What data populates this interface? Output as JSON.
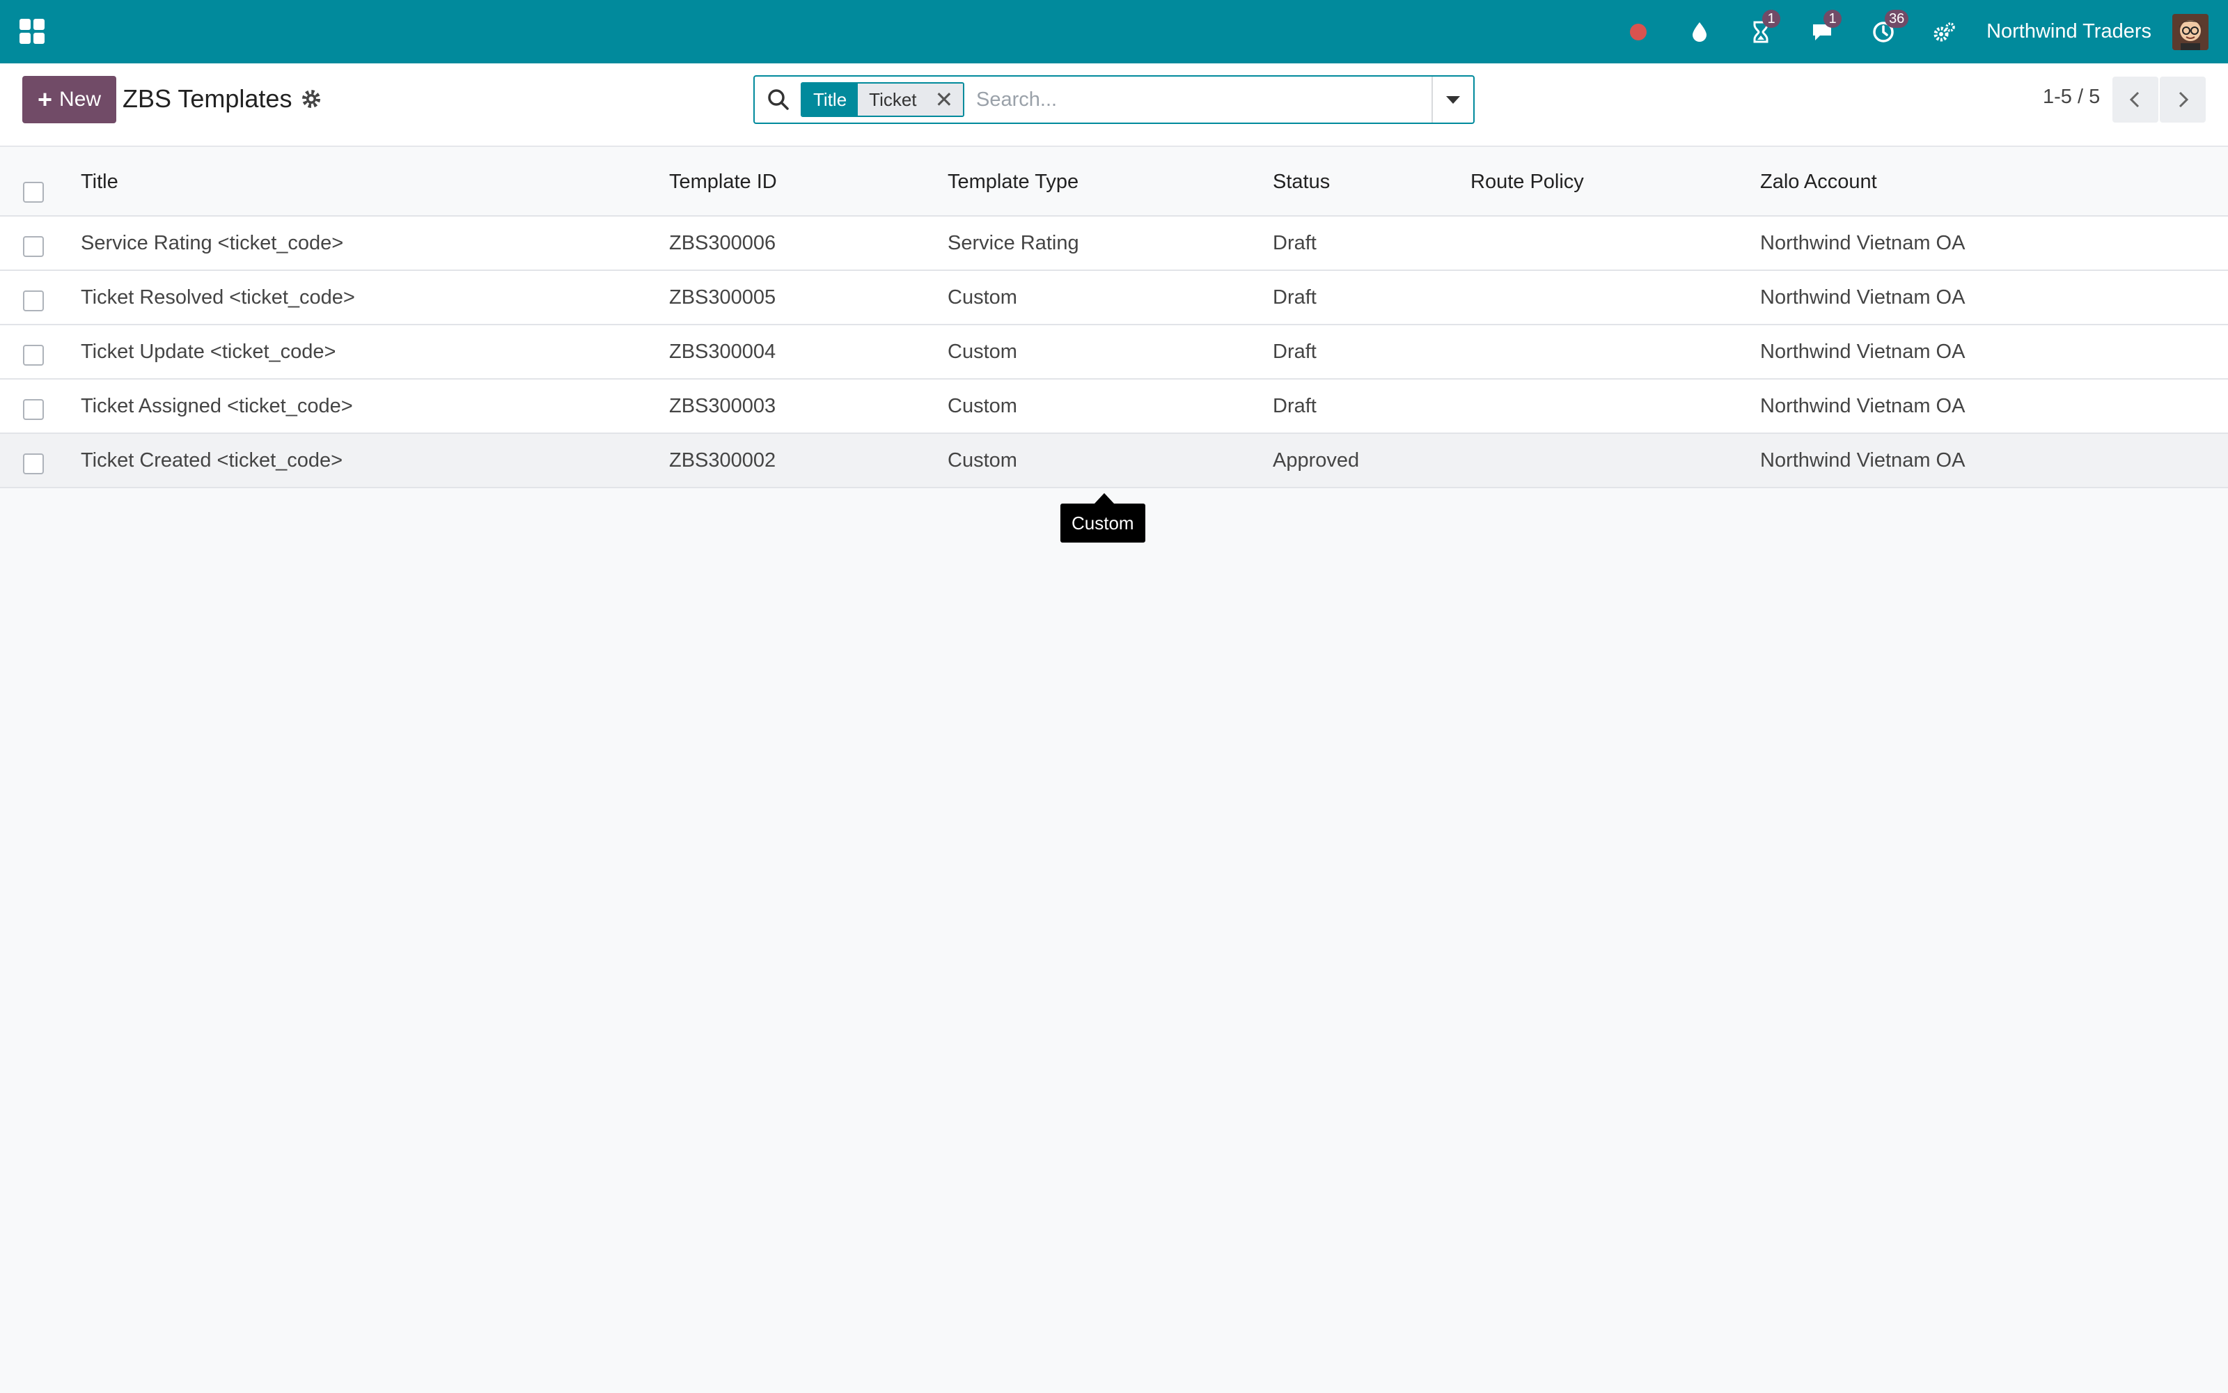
{
  "colors": {
    "navbar": "#018a9c",
    "primary_button": "#714b67",
    "badge": "#714b67",
    "recording_dot": "#d9534f"
  },
  "navbar": {
    "apps_icon": "grid-icon",
    "icons": [
      {
        "name": "recording-dot-icon",
        "badge": ""
      },
      {
        "name": "drop-icon",
        "badge": ""
      },
      {
        "name": "hourglass-icon",
        "badge": "1"
      },
      {
        "name": "chat-icon",
        "badge": "1"
      },
      {
        "name": "activity-clock-icon",
        "badge": "36"
      },
      {
        "name": "settings-cogs-icon",
        "badge": ""
      }
    ],
    "company": "Northwind Traders",
    "avatar_icon": "user-avatar"
  },
  "control_panel": {
    "new_label": "New",
    "title": "ZBS Templates",
    "search": {
      "facet_label": "Title",
      "facet_value": "Ticket",
      "placeholder": "Search..."
    },
    "pager": {
      "value": "1-5 / 5"
    }
  },
  "table": {
    "columns": [
      "Title",
      "Template ID",
      "Template Type",
      "Status",
      "Route Policy",
      "Zalo Account"
    ],
    "rows": [
      {
        "title": "Service Rating <ticket_code>",
        "template_id": "ZBS300006",
        "template_type": "Service Rating",
        "status": "Draft",
        "route_policy": "",
        "zalo_account": "Northwind Vietnam OA"
      },
      {
        "title": "Ticket Resolved <ticket_code>",
        "template_id": "ZBS300005",
        "template_type": "Custom",
        "status": "Draft",
        "route_policy": "",
        "zalo_account": "Northwind Vietnam OA"
      },
      {
        "title": "Ticket Update <ticket_code>",
        "template_id": "ZBS300004",
        "template_type": "Custom",
        "status": "Draft",
        "route_policy": "",
        "zalo_account": "Northwind Vietnam OA"
      },
      {
        "title": "Ticket Assigned <ticket_code>",
        "template_id": "ZBS300003",
        "template_type": "Custom",
        "status": "Draft",
        "route_policy": "",
        "zalo_account": "Northwind Vietnam OA"
      },
      {
        "title": "Ticket Created <ticket_code>",
        "template_id": "ZBS300002",
        "template_type": "Custom",
        "status": "Approved",
        "route_policy": "",
        "zalo_account": "Northwind Vietnam OA"
      }
    ]
  },
  "tooltip": {
    "text": "Custom"
  }
}
